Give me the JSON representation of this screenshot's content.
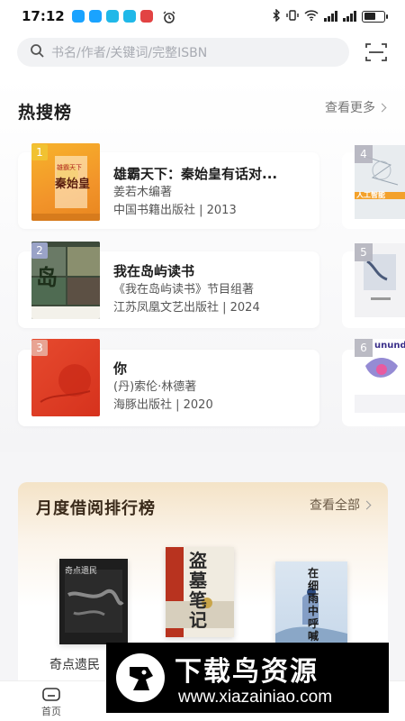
{
  "status_bar": {
    "time": "17:12",
    "notification_icons": [
      "app-blue-icon",
      "app-blue-icon",
      "app-cyan-icon",
      "app-cyan-icon",
      "app-red-icon",
      "alarm-icon"
    ],
    "notification_colors": [
      "#1aa3ff",
      "#1aa3ff",
      "#20b8e8",
      "#20b8e8",
      "#e24343"
    ],
    "right_icons": [
      "bluetooth-icon",
      "vibrate-icon",
      "wifi-icon",
      "signal-icon",
      "signal-icon",
      "battery-icon"
    ],
    "battery_level": 0.6
  },
  "search": {
    "placeholder": "书名/作者/关键词/完整ISBN",
    "icon": "search-icon",
    "scan_icon": "scan-icon"
  },
  "hot": {
    "title": "热搜榜",
    "more_label": "查看更多",
    "rank_badge_colors": [
      "#f1c232",
      "#9aa3c7",
      "#e8a493"
    ],
    "items": [
      {
        "rank": "1",
        "title": "雄霸天下：秦始皇有话对...",
        "author": "姜若木编著",
        "publisher": "中国书籍出版社 | 2013",
        "cover": "秦始皇",
        "cover_top": "雄霸天下"
      },
      {
        "rank": "2",
        "title": "我在岛屿读书",
        "author": "《我在岛屿读书》节目组著",
        "publisher": "江苏凤凰文艺出版社 | 2024",
        "cover": "岛"
      },
      {
        "rank": "3",
        "title": "你",
        "author": "(丹)索伦·林德著",
        "publisher": "海豚出版社 | 2020",
        "cover": ""
      }
    ],
    "side_items": [
      {
        "rank": "4",
        "cover": "人工智能"
      },
      {
        "rank": "5",
        "cover": ""
      },
      {
        "rank": "6",
        "cover": "unundrum"
      }
    ]
  },
  "monthly": {
    "title": "月度借阅排行榜",
    "more_label": "查看全部",
    "books": [
      {
        "name": "奇点遗民",
        "cover": "奇点遗民"
      },
      {
        "name": "",
        "cover": "盗墓笔记"
      },
      {
        "name": "",
        "cover": "在细雨中呼喊"
      }
    ]
  },
  "tabbar": {
    "tabs": [
      {
        "label": "首页",
        "icon": "home-icon"
      },
      {
        "label": "",
        "icon": "category-icon"
      },
      {
        "label": "",
        "icon": "shelf-icon"
      },
      {
        "label": "",
        "icon": "profile-icon"
      }
    ]
  },
  "watermark": {
    "title": "下载鸟资源",
    "url": "www.xiazainiao.com"
  },
  "colors": {
    "accent": "#f1c232",
    "monthly_bg": "#f4e3c7"
  }
}
